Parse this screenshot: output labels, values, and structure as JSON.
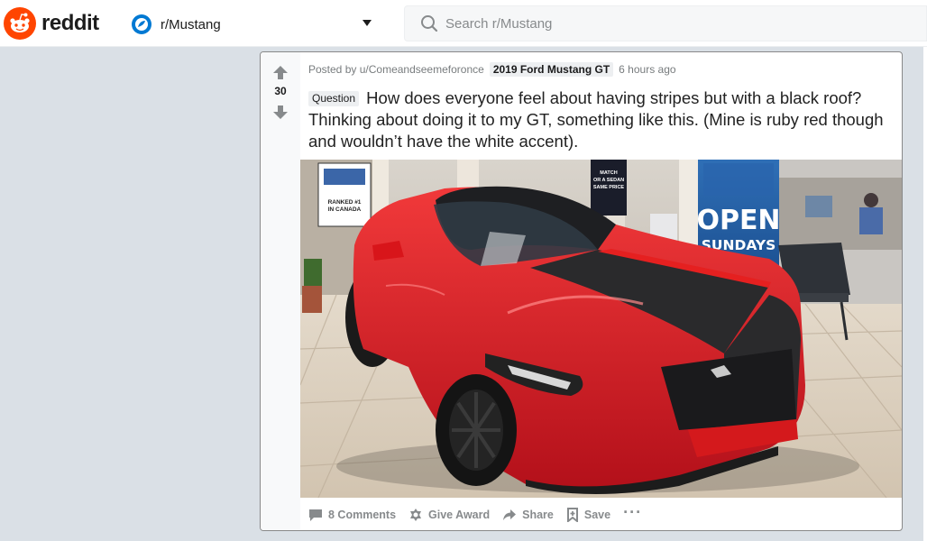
{
  "header": {
    "logo_text": "reddit",
    "community": "r/Mustang",
    "search_placeholder": "Search r/Mustang"
  },
  "post": {
    "votes": "30",
    "posted_by_prefix": "Posted by",
    "author": "u/Comeandseemeforonce",
    "user_flair": "2019 Ford Mustang GT",
    "time_ago": "6 hours ago",
    "link_flair": "Question",
    "title": "How does everyone feel about having stripes but with a black roof? Thinking about doing it to my GT, something like this. (Mine is ruby red though and wouldn’t have the white accent).",
    "image": {
      "poster_ranked": "RANKED #1",
      "poster_canada": "IN CANADA",
      "sign_open": "OPEN",
      "sign_sundays": "SUNDAYS",
      "small_sign": "MATCH\nOR A SEDAN\nSAME PRICE"
    },
    "actions": {
      "comments": "8 Comments",
      "award": "Give Award",
      "share": "Share",
      "save": "Save",
      "more": "···"
    }
  },
  "colors": {
    "brand": "#ff4500",
    "car_red": "#e0191c",
    "stripe": "#2a2a2c",
    "sign_blue": "#1f5fa8"
  }
}
